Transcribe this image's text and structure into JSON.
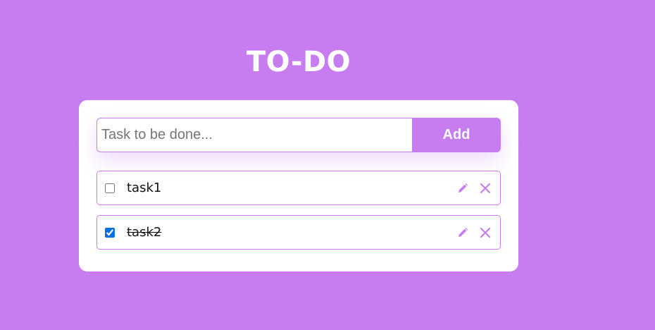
{
  "app": {
    "title": "TO-DO"
  },
  "add_form": {
    "input_value": "",
    "input_placeholder": "Task to be done...",
    "add_label": "Add"
  },
  "tasks": [
    {
      "text": "task1",
      "completed": false
    },
    {
      "text": "task2",
      "completed": true
    }
  ],
  "icons": {
    "edit": "pencil-icon",
    "delete": "close-icon"
  },
  "colors": {
    "background": "#c77df0",
    "accent": "#c77df0",
    "card": "#ffffff",
    "checkbox": "#0b6ee0"
  }
}
